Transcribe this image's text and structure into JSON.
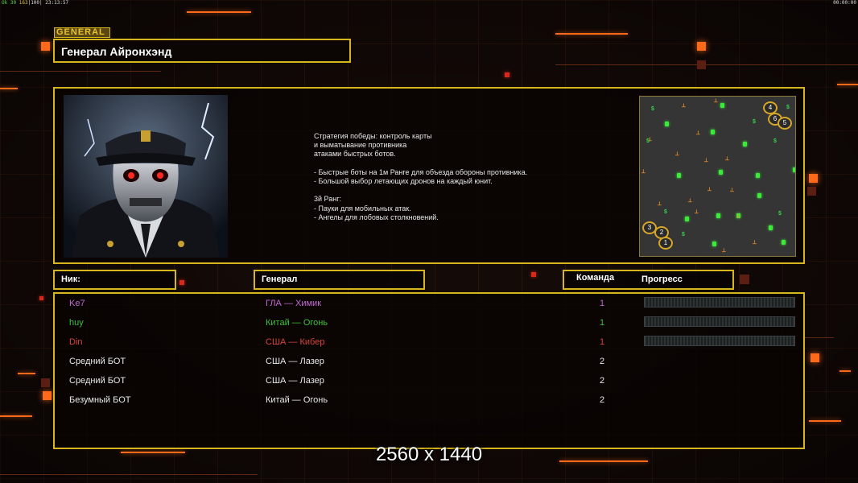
{
  "status_bar": {
    "fps_label": "Ok",
    "fps_a": "30",
    "fps_b": "163",
    "fps_c": "100",
    "clock": "23:13:57",
    "timer": "00:00:00"
  },
  "general_panel": {
    "tag": "GENERAL",
    "title": "Генерал Айронхэнд",
    "description": "Стратегия победы: контроль карты\nи выматывание противника\nатаками быстрых ботов.\n\n- Быстрые боты на 1м Ранге для объезда обороны противника.\n- Большой выбор летающих дронов на каждый юнит.\n\n3й Ранг:\n- Пауки для мобильных атак.\n- Ангелы для лобовых столкновений."
  },
  "minimap": {
    "start_positions": [
      "4",
      "6",
      "5",
      "3",
      "2",
      "1"
    ],
    "supply_marker": "$"
  },
  "table": {
    "headers": {
      "nick": "Ник:",
      "general": "Генерал",
      "team": "Команда",
      "progress": "Прогресс"
    },
    "rows": [
      {
        "nick": "Ke7",
        "general": "ГЛА — Химик",
        "team": "1",
        "color": "#c467d8",
        "progress": 0
      },
      {
        "nick": "huy",
        "general": "Китай — Огонь",
        "team": "1",
        "color": "#3dc23a",
        "progress": 0
      },
      {
        "nick": "Din",
        "general": "США — Кибер",
        "team": "1",
        "color": "#d8453c",
        "progress": 0
      },
      {
        "nick": "Средний БОТ",
        "general": "США — Лазер",
        "team": "2",
        "color": "#e8e8e8"
      },
      {
        "nick": "Средний БОТ",
        "general": "США — Лазер",
        "team": "2",
        "color": "#e8e8e8"
      },
      {
        "nick": "Безумный БОТ",
        "general": "Китай — Огонь",
        "team": "2",
        "color": "#e8e8e8"
      }
    ]
  },
  "overlay": {
    "resolution": "2560 x 1440"
  },
  "colors": {
    "accent_frame": "#d7b51d",
    "accent_orange": "#ff6a1a",
    "background": "#140a07"
  }
}
